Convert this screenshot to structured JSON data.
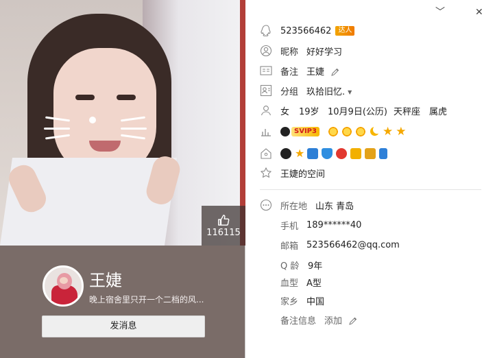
{
  "profile": {
    "name": "王婕",
    "signature": "晚上宿舍里只开一个二档的风...",
    "send_message_label": "发消息",
    "likes": "116115"
  },
  "window": {
    "minimize_glyph": "﹀",
    "close_glyph": "✕"
  },
  "info": {
    "qq_number": "523566462",
    "daren_badge": "达人",
    "nickname_label": "昵称",
    "nickname": "好好学习",
    "remark_label": "备注",
    "remark": "王婕",
    "group_label": "分组",
    "group": "玖拾旧忆.",
    "gender": "女",
    "age": "19岁",
    "birthday": "10月9日(公历)",
    "zodiac": "天秤座",
    "chinese_zodiac": "属虎",
    "svip_label": "SVIP3",
    "qzone_link": "王婕的空间",
    "location_label": "所在地",
    "location": "山东 青岛",
    "phone_label": "手机",
    "phone": "189******40",
    "email_label": "邮箱",
    "email": "523566462@qq.com",
    "qage_label": "Q 龄",
    "qage": "9年",
    "blood_label": "血型",
    "blood": "A型",
    "hometown_label": "家乡",
    "hometown": "中国",
    "remark_info_label": "备注信息",
    "remark_info_add": "添加"
  },
  "icons": {
    "level": [
      "sun",
      "sun",
      "sun",
      "moon",
      "star",
      "star"
    ],
    "services": [
      "qq-penguin",
      "yellow-star",
      "camera",
      "shield",
      "music-red",
      "yellow-chat",
      "book",
      "phone"
    ]
  },
  "colors": {
    "left_panel_bg": "#7a6c68",
    "accent_orange": "#f5a800",
    "svip_red": "#d21b1b"
  }
}
